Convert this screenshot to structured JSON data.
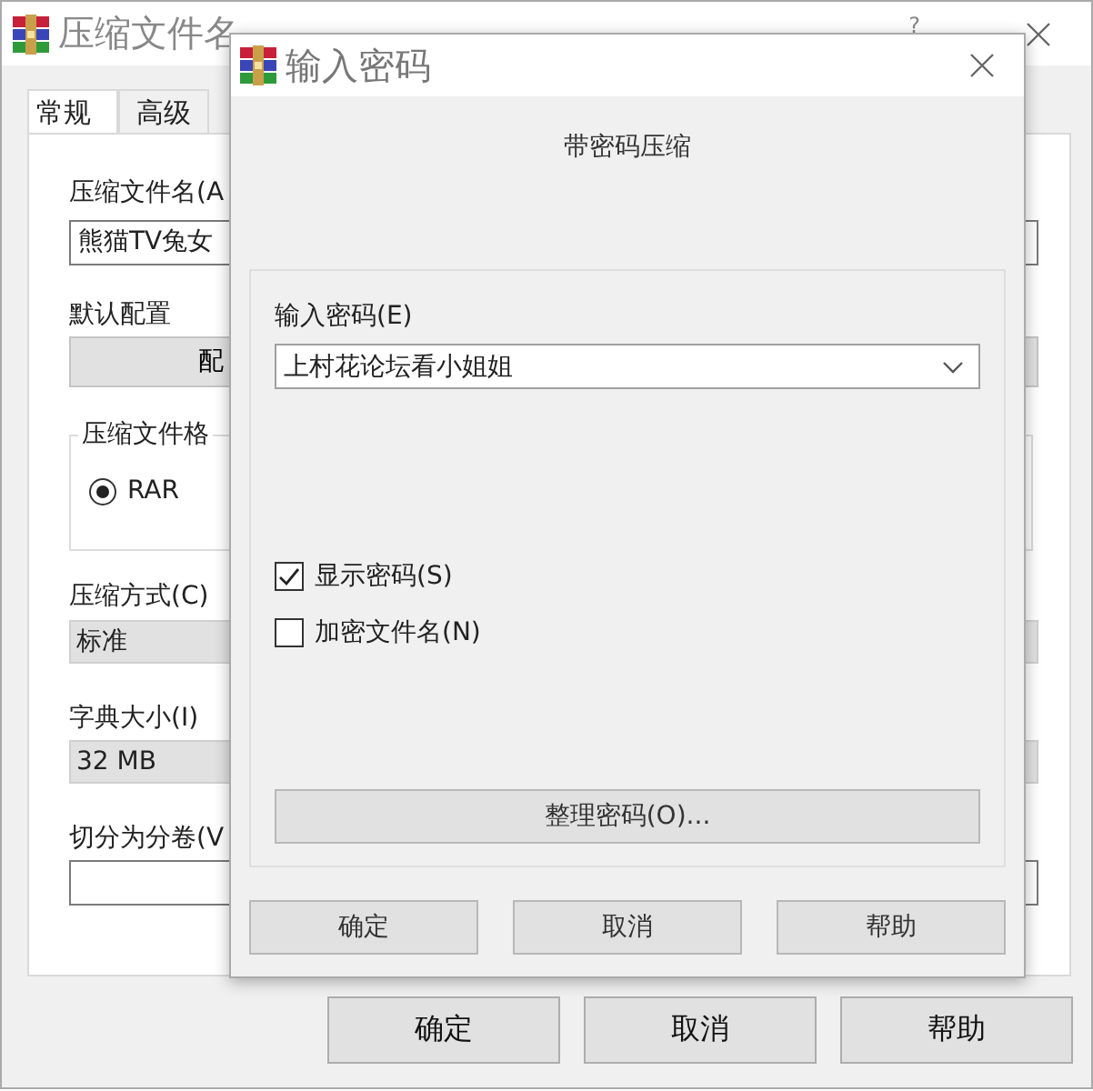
{
  "main_window": {
    "title": "压缩文件名",
    "help_glyph": "?",
    "tabs": [
      {
        "label": "常规",
        "selected": true
      },
      {
        "label": "高级",
        "selected": false
      }
    ],
    "archive_name": {
      "label": "压缩文件名(A",
      "value": "熊猫TV兔女"
    },
    "default_profile": {
      "label": "默认配置",
      "button": "配"
    },
    "format_group": {
      "title": "压缩文件格",
      "options": [
        {
          "label": "RAR",
          "selected": true
        }
      ]
    },
    "method": {
      "label": "压缩方式(C)",
      "value": "标准"
    },
    "dictionary": {
      "label": "字典大小(I)",
      "value": "32 MB"
    },
    "split": {
      "label": "切分为分卷(V"
    },
    "buttons": [
      "确定",
      "取消",
      "帮助"
    ]
  },
  "dialog": {
    "title": "输入密码",
    "heading": "带密码压缩",
    "password": {
      "label": "输入密码(E)",
      "value": "上村花论坛看小姐姐"
    },
    "options": [
      {
        "label": "显示密码(S)",
        "checked": true
      },
      {
        "label": "加密文件名(N)",
        "checked": false
      }
    ],
    "organize_button": "整理密码(O)...",
    "buttons": [
      "确定",
      "取消",
      "帮助"
    ]
  }
}
